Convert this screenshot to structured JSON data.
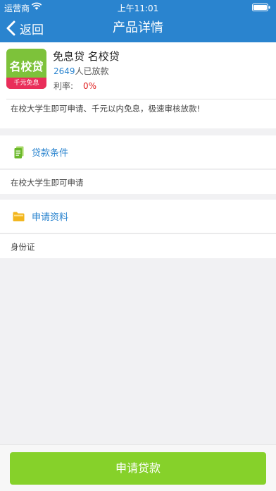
{
  "status_bar": {
    "carrier": "运营商",
    "time": "上午11:01"
  },
  "nav": {
    "back_label": "返回",
    "title": "产品详情"
  },
  "product": {
    "logo_text": "名校贷",
    "logo_badge": "千元免息",
    "name": "免息贷 名校贷",
    "lend_count": "2649",
    "lend_suffix": "人已放款",
    "rate_label": "利率:",
    "rate_value": "0%",
    "description": "在校大学生即可申请、千元以内免息，极速审核放款!"
  },
  "sections": {
    "conditions": {
      "title": "贷款条件",
      "text": "在校大学生即可申请",
      "icon": "document-icon"
    },
    "materials": {
      "title": "申请资料",
      "text": "身份证",
      "icon": "folder-icon"
    }
  },
  "footer": {
    "apply_label": "申请贷款"
  },
  "colors": {
    "header": "#2a84cf",
    "accent_blue": "#2a84cf",
    "rate_red": "#e02020",
    "apply_green": "#86d12a",
    "logo_green": "#7dc23a",
    "logo_pink": "#e92e5a"
  }
}
